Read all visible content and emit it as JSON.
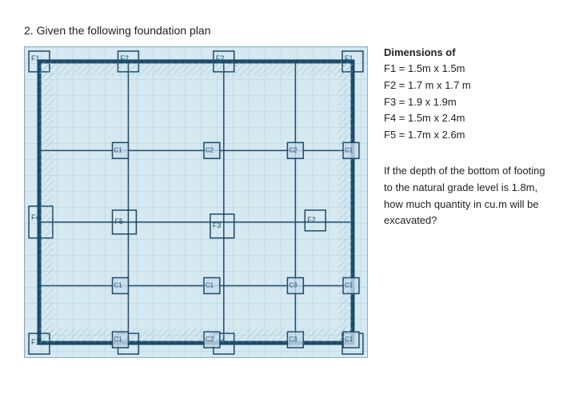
{
  "question": {
    "number": "2.",
    "label": "Given the following foundation plan"
  },
  "dimensions": {
    "title": "Dimensions of",
    "items": [
      "F1 = 1.5m x 1.5m",
      "F2 = 1.7 m x 1.7 m",
      "F3 = 1.9 x 1.9m",
      "F4 = 1.5m x 2.4m",
      "F5 = 1.7m x 2.6m"
    ]
  },
  "question_text": "If the depth of the bottom of footing to the natural grade level is 1.8m, how much quantity in cu.m will be excavated?",
  "footing_labels": {
    "f1_top_left": "F1",
    "f2_top_mid1": "F2",
    "f2_top_mid2": "F2",
    "f1_top_right": "F1",
    "c1_1": "C1",
    "c2_1": "C2",
    "c2_2": "C2",
    "c1_2": "C1",
    "f4_mid_left": "F4",
    "f5_mid": "F5",
    "f3_mid": "F3",
    "f2_mid_right": "F2",
    "c1_3": "C1",
    "c1_4": "C1",
    "c3_1": "C3",
    "c1_5": "C1",
    "f1_bot_left": "F1",
    "f2_bot_mid1": "F2",
    "f2_bot_mid2": "F2",
    "f1_bot_right": "F1",
    "c1_6": "C1",
    "c2_3": "C2",
    "c3_2": "C3",
    "c1_7": "C1"
  }
}
